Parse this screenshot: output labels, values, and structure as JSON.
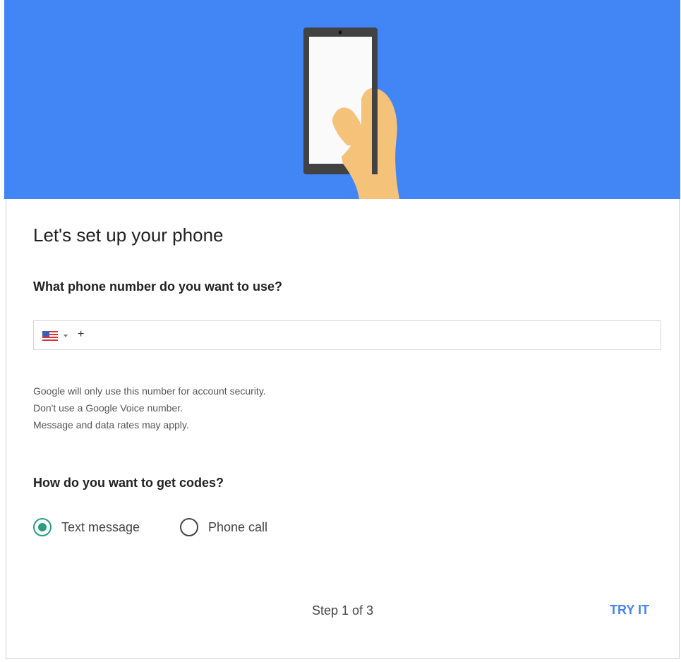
{
  "header": {
    "illustration": "hand-holding-phone-illustration",
    "background_color": "#4285f4"
  },
  "title": "Let's set up your phone",
  "phone_question": "What phone number do you want to use?",
  "phone_field": {
    "country": "US",
    "flag_icon": "us-flag-icon",
    "prefix": "+",
    "value": ""
  },
  "help_lines": [
    "Google will only use this number for account security.",
    "Don't use a Google Voice number.",
    "Message and data rates may apply."
  ],
  "codes_question": "How do you want to get codes?",
  "options": [
    {
      "label": "Text message",
      "checked": true
    },
    {
      "label": "Phone call",
      "checked": false
    }
  ],
  "step": "Step 1 of 3",
  "action_label": "TRY IT",
  "colors": {
    "accent": "#4285f4",
    "radio_selected": "#2a9d7e"
  }
}
